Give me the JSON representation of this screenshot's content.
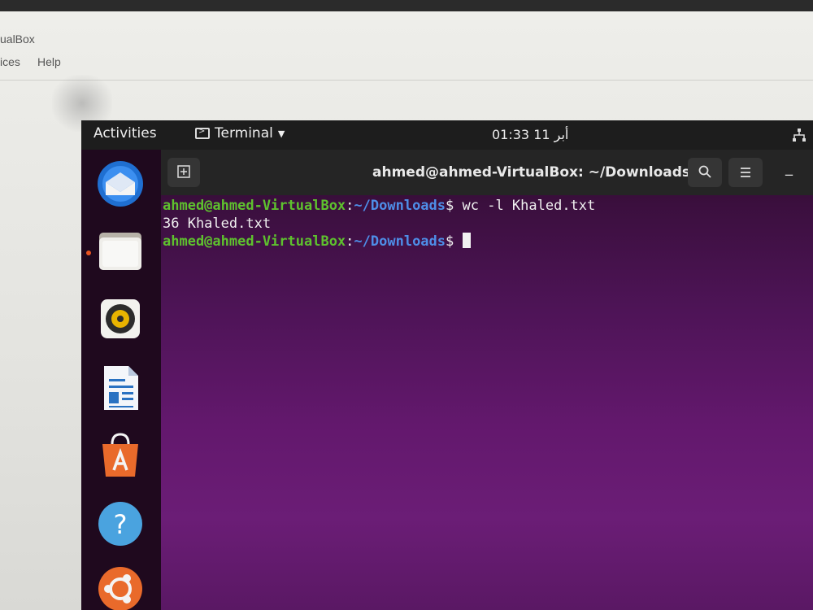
{
  "host": {
    "title": "ualBox",
    "menu": [
      "ices",
      "Help"
    ]
  },
  "topbar": {
    "activities": "Activities",
    "app_name": "Terminal",
    "clock": "أبر 11  01:33"
  },
  "dock": {
    "items": [
      {
        "name": "thunderbird-icon"
      },
      {
        "name": "files-icon",
        "running": true
      },
      {
        "name": "rhythmbox-icon"
      },
      {
        "name": "libreoffice-writer-icon"
      },
      {
        "name": "ubuntu-software-icon"
      },
      {
        "name": "help-icon"
      },
      {
        "name": "ubuntu-icon"
      }
    ]
  },
  "terminal": {
    "title": "ahmed@ahmed-VirtualBox: ~/Downloads",
    "lines": [
      {
        "user": "ahmed@ahmed-VirtualBox",
        "sep": ":",
        "path": "~/Downloads",
        "prompt": "$ ",
        "command": "wc -l Khaled.txt"
      },
      {
        "output": "36 Khaled.txt"
      },
      {
        "user": "ahmed@ahmed-VirtualBox",
        "sep": ":",
        "path": "~/Downloads",
        "prompt": "$ ",
        "command": ""
      }
    ]
  },
  "colors": {
    "prompt_user": "#5ec12e",
    "prompt_path": "#4e8ee8",
    "terminal_bg": "#5a1864",
    "ubuntu_orange": "#e95420"
  }
}
